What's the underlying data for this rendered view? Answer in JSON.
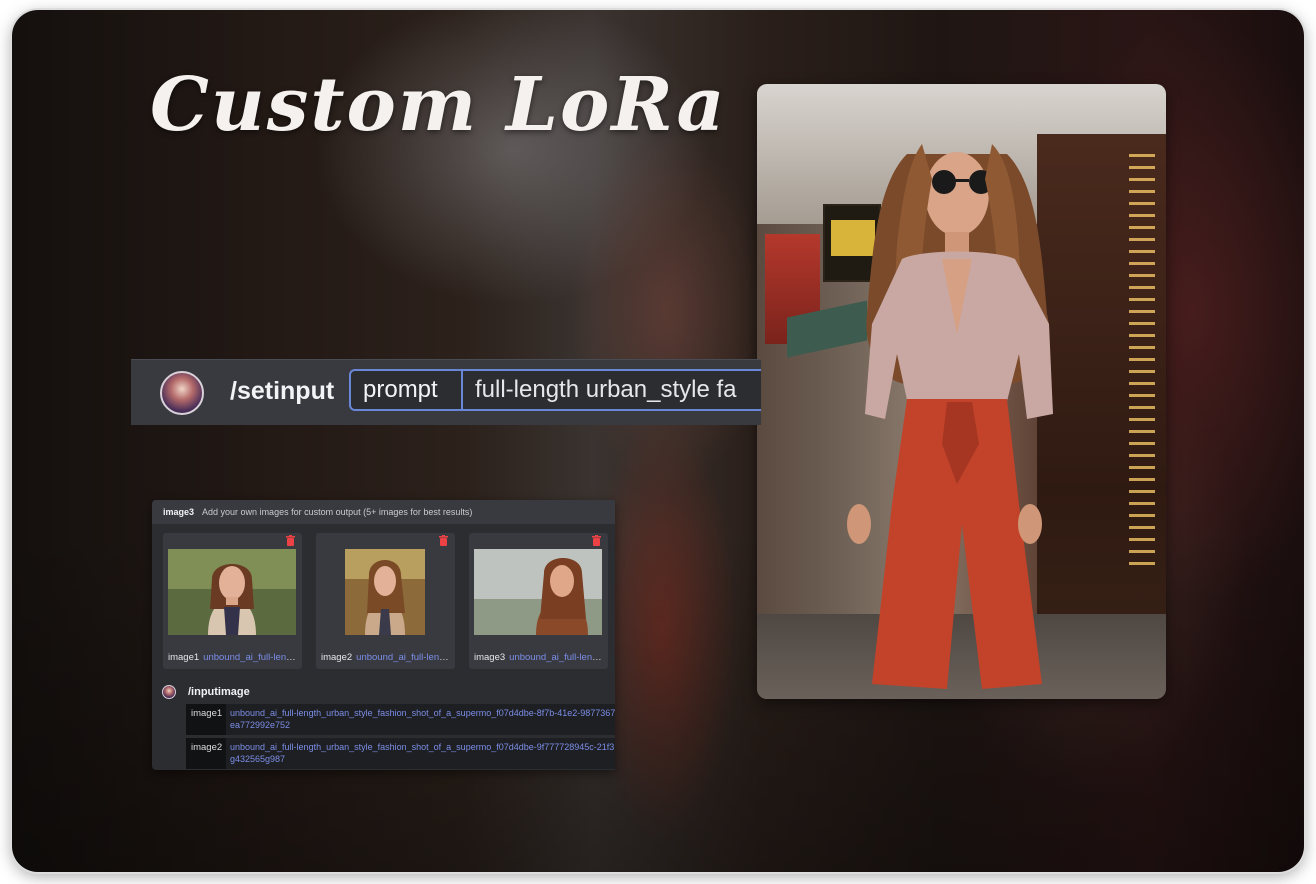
{
  "hero": {
    "title": "Custom LoRa"
  },
  "command_bar": {
    "command": "/setinput",
    "param_label": "prompt",
    "param_value": "full-length urban_style fa"
  },
  "upload_panel": {
    "field_name": "image3",
    "hint": "Add your own images for custom output (5+ images for best results)",
    "tiles": [
      {
        "label": "image1",
        "filename": "unbound_ai_full-lengt...",
        "delete_icon": "trash-icon"
      },
      {
        "label": "image2",
        "filename": "unbound_ai_full-lengt...",
        "delete_icon": "trash-icon"
      },
      {
        "label": "image3",
        "filename": "unbound_ai_full-lengt...",
        "delete_icon": "trash-icon"
      }
    ]
  },
  "inputimage": {
    "command": "/inputimage",
    "entries": [
      {
        "key": "image1",
        "value": "unbound_ai_full-length_urban_style_fashion_shot_of_a_supermo_f07d4dbe-8f7b-41e2-9877367 ea772992e752"
      },
      {
        "key": "image2",
        "value": "unbound_ai_full-length_urban_style_fashion_shot_of_a_supermo_f07d4dbe-9f777728945c-21f3 fg432565g987"
      }
    ]
  },
  "colors": {
    "panel_bg": "#2b2d31",
    "bar_bg": "#383a40",
    "accent_border": "#6a86d6",
    "link": "#7b8ee8",
    "delete": "#ed4245"
  }
}
